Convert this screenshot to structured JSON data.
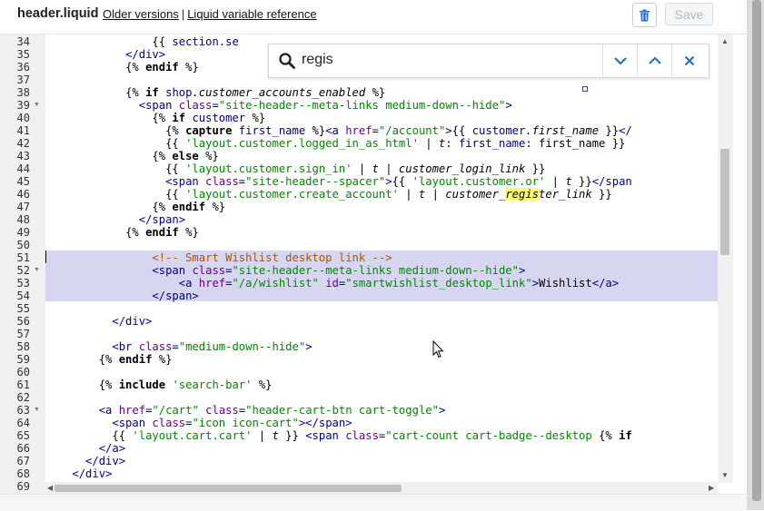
{
  "header": {
    "file_name": "header.liquid",
    "older_versions": "Older versions",
    "separator": "|",
    "liquid_reference": "Liquid variable reference",
    "save_label": "Save"
  },
  "search": {
    "query": "regis"
  },
  "colors": {
    "selection": "#d6d6f0",
    "match_highlight": "#ffff77",
    "save_disabled": "#b3bac2",
    "icon_blue": "#2c6ecb"
  },
  "icons": {
    "trash": "trash-icon",
    "search": "search-icon",
    "next": "chevron-down-icon",
    "prev": "chevron-up-icon",
    "close": "close-icon"
  },
  "lines": [
    {
      "n": "34",
      "fold": false
    },
    {
      "n": "35",
      "fold": false
    },
    {
      "n": "36",
      "fold": false
    },
    {
      "n": "37",
      "fold": false
    },
    {
      "n": "38",
      "fold": false
    },
    {
      "n": "39",
      "fold": true
    },
    {
      "n": "40",
      "fold": false
    },
    {
      "n": "41",
      "fold": false
    },
    {
      "n": "42",
      "fold": false
    },
    {
      "n": "43",
      "fold": false
    },
    {
      "n": "44",
      "fold": false
    },
    {
      "n": "45",
      "fold": false
    },
    {
      "n": "46",
      "fold": false
    },
    {
      "n": "47",
      "fold": false
    },
    {
      "n": "48",
      "fold": false
    },
    {
      "n": "49",
      "fold": false
    },
    {
      "n": "50",
      "fold": false
    },
    {
      "n": "51",
      "fold": false
    },
    {
      "n": "52",
      "fold": true
    },
    {
      "n": "53",
      "fold": false
    },
    {
      "n": "54",
      "fold": false
    },
    {
      "n": "55",
      "fold": false
    },
    {
      "n": "56",
      "fold": false
    },
    {
      "n": "57",
      "fold": false
    },
    {
      "n": "58",
      "fold": false
    },
    {
      "n": "59",
      "fold": false
    },
    {
      "n": "60",
      "fold": false
    },
    {
      "n": "61",
      "fold": false
    },
    {
      "n": "62",
      "fold": false
    },
    {
      "n": "63",
      "fold": true
    },
    {
      "n": "64",
      "fold": false
    },
    {
      "n": "65",
      "fold": false
    },
    {
      "n": "66",
      "fold": false
    },
    {
      "n": "67",
      "fold": false
    },
    {
      "n": "68",
      "fold": false
    },
    {
      "n": "69",
      "fold": false
    }
  ],
  "code": [
    {
      "indent": 16,
      "tokens": [
        {
          "t": "{{ ",
          "c": "liq"
        },
        {
          "t": "section.se",
          "c": "var"
        }
      ]
    },
    {
      "indent": 12,
      "tokens": [
        {
          "t": "</div>",
          "c": "tag"
        }
      ]
    },
    {
      "indent": 12,
      "tokens": [
        {
          "t": "{% ",
          "c": "liq"
        },
        {
          "t": "endif",
          "c": "kw"
        },
        {
          "t": " %}",
          "c": "liq"
        }
      ]
    },
    {
      "indent": 0,
      "tokens": []
    },
    {
      "indent": 12,
      "tokens": [
        {
          "t": "{% ",
          "c": "liq"
        },
        {
          "t": "if",
          "c": "kw"
        },
        {
          "t": " shop",
          "c": "var"
        },
        {
          "t": ".customer_accounts_enabled",
          "c": "it"
        },
        {
          "t": " %}",
          "c": "liq"
        }
      ]
    },
    {
      "indent": 14,
      "tokens": [
        {
          "t": "<span ",
          "c": "tag"
        },
        {
          "t": "class",
          "c": "attr"
        },
        {
          "t": "=",
          "c": "tag"
        },
        {
          "t": "\"site-header--meta-links medium-down--hide\"",
          "c": "str"
        },
        {
          "t": ">",
          "c": "tag"
        }
      ]
    },
    {
      "indent": 16,
      "tokens": [
        {
          "t": "{% ",
          "c": "liq"
        },
        {
          "t": "if",
          "c": "kw"
        },
        {
          "t": " customer",
          "c": "var"
        },
        {
          "t": " %}",
          "c": "liq"
        }
      ]
    },
    {
      "indent": 18,
      "tokens": [
        {
          "t": "{% ",
          "c": "liq"
        },
        {
          "t": "capture",
          "c": "kw"
        },
        {
          "t": " first_name",
          "c": "var"
        },
        {
          "t": " %}",
          "c": "liq"
        },
        {
          "t": "<a ",
          "c": "tag"
        },
        {
          "t": "href",
          "c": "attr"
        },
        {
          "t": "=",
          "c": "tag"
        },
        {
          "t": "\"/account\"",
          "c": "str"
        },
        {
          "t": ">",
          "c": "tag"
        },
        {
          "t": "{{ ",
          "c": "liq"
        },
        {
          "t": "customer",
          "c": "var"
        },
        {
          "t": ".first_name",
          "c": "it"
        },
        {
          "t": " }}",
          "c": "liq"
        },
        {
          "t": "</",
          "c": "tag"
        }
      ]
    },
    {
      "indent": 18,
      "tokens": [
        {
          "t": "{{ ",
          "c": "liq"
        },
        {
          "t": "'layout.customer.logged_in_as_html'",
          "c": "lstr"
        },
        {
          "t": " | ",
          "c": "pipe"
        },
        {
          "t": "t",
          "c": "it"
        },
        {
          "t": ": ",
          "c": "liq"
        },
        {
          "t": "first_name",
          "c": "var"
        },
        {
          "t": ": first_name }}",
          "c": "liq"
        }
      ]
    },
    {
      "indent": 16,
      "tokens": [
        {
          "t": "{% ",
          "c": "liq"
        },
        {
          "t": "else",
          "c": "kw"
        },
        {
          "t": " %}",
          "c": "liq"
        }
      ]
    },
    {
      "indent": 18,
      "tokens": [
        {
          "t": "{{ ",
          "c": "liq"
        },
        {
          "t": "'layout.customer.sign_in'",
          "c": "lstr"
        },
        {
          "t": " | ",
          "c": "pipe"
        },
        {
          "t": "t",
          "c": "it"
        },
        {
          "t": " | ",
          "c": "pipe"
        },
        {
          "t": "customer_login_link",
          "c": "it"
        },
        {
          "t": " }}",
          "c": "liq"
        }
      ]
    },
    {
      "indent": 18,
      "tokens": [
        {
          "t": "<span ",
          "c": "tag"
        },
        {
          "t": "class",
          "c": "attr"
        },
        {
          "t": "=",
          "c": "tag"
        },
        {
          "t": "\"site-header--spacer\"",
          "c": "str"
        },
        {
          "t": ">",
          "c": "tag"
        },
        {
          "t": "{{ ",
          "c": "liq"
        },
        {
          "t": "'layout.customer.or'",
          "c": "lstr"
        },
        {
          "t": " | ",
          "c": "pipe"
        },
        {
          "t": "t",
          "c": "it"
        },
        {
          "t": " }}",
          "c": "liq"
        },
        {
          "t": "</span",
          "c": "tag"
        }
      ]
    },
    {
      "indent": 18,
      "tokens": [
        {
          "t": "{{ ",
          "c": "liq"
        },
        {
          "t": "'layout.customer.create_account'",
          "c": "lstr"
        },
        {
          "t": " | ",
          "c": "pipe"
        },
        {
          "t": "t",
          "c": "it"
        },
        {
          "t": " | ",
          "c": "pipe"
        },
        {
          "t": "customer_",
          "c": "it"
        },
        {
          "t": "regis",
          "c": "ithl"
        },
        {
          "t": "ter_link",
          "c": "it"
        },
        {
          "t": " }}",
          "c": "liq"
        }
      ]
    },
    {
      "indent": 16,
      "tokens": [
        {
          "t": "{% ",
          "c": "liq"
        },
        {
          "t": "endif",
          "c": "kw"
        },
        {
          "t": " %}",
          "c": "liq"
        }
      ]
    },
    {
      "indent": 14,
      "tokens": [
        {
          "t": "</span>",
          "c": "tag"
        }
      ]
    },
    {
      "indent": 12,
      "tokens": [
        {
          "t": "{% ",
          "c": "liq"
        },
        {
          "t": "endif",
          "c": "kw"
        },
        {
          "t": " %}",
          "c": "liq"
        }
      ]
    },
    {
      "indent": 0,
      "tokens": []
    },
    {
      "indent": 16,
      "tokens": [
        {
          "t": "<!-- Smart Wishlist desktop link -->",
          "c": "cmt"
        }
      ]
    },
    {
      "indent": 16,
      "tokens": [
        {
          "t": "<span ",
          "c": "tag"
        },
        {
          "t": "class",
          "c": "attr"
        },
        {
          "t": "=",
          "c": "tag"
        },
        {
          "t": "\"site-header--meta-links medium-down--hide\"",
          "c": "str"
        },
        {
          "t": ">",
          "c": "tag"
        }
      ]
    },
    {
      "indent": 20,
      "tokens": [
        {
          "t": "<a ",
          "c": "tag"
        },
        {
          "t": "href",
          "c": "attr"
        },
        {
          "t": "=",
          "c": "tag"
        },
        {
          "t": "\"/a/wishlist\"",
          "c": "str"
        },
        {
          "t": " ",
          "c": "tag"
        },
        {
          "t": "id",
          "c": "attr"
        },
        {
          "t": "=",
          "c": "tag"
        },
        {
          "t": "\"smartwishlist_desktop_link\"",
          "c": "str"
        },
        {
          "t": ">",
          "c": "tag"
        },
        {
          "t": "Wishlist",
          "c": "liq"
        },
        {
          "t": "</a>",
          "c": "tag"
        }
      ]
    },
    {
      "indent": 16,
      "tokens": [
        {
          "t": "</span>",
          "c": "tag"
        }
      ]
    },
    {
      "indent": 0,
      "tokens": []
    },
    {
      "indent": 10,
      "tokens": [
        {
          "t": "</div>",
          "c": "tag"
        }
      ]
    },
    {
      "indent": 0,
      "tokens": []
    },
    {
      "indent": 10,
      "tokens": [
        {
          "t": "<br ",
          "c": "tag"
        },
        {
          "t": "class",
          "c": "attr"
        },
        {
          "t": "=",
          "c": "tag"
        },
        {
          "t": "\"medium-down--hide\"",
          "c": "str"
        },
        {
          "t": ">",
          "c": "tag"
        }
      ]
    },
    {
      "indent": 8,
      "tokens": [
        {
          "t": "{% ",
          "c": "liq"
        },
        {
          "t": "endif",
          "c": "kw"
        },
        {
          "t": " %}",
          "c": "liq"
        }
      ]
    },
    {
      "indent": 0,
      "tokens": []
    },
    {
      "indent": 8,
      "tokens": [
        {
          "t": "{% ",
          "c": "liq"
        },
        {
          "t": "include",
          "c": "kw"
        },
        {
          "t": " ",
          "c": "liq"
        },
        {
          "t": "'search-bar'",
          "c": "lstr"
        },
        {
          "t": " %}",
          "c": "liq"
        }
      ]
    },
    {
      "indent": 0,
      "tokens": []
    },
    {
      "indent": 8,
      "tokens": [
        {
          "t": "<a ",
          "c": "tag"
        },
        {
          "t": "href",
          "c": "attr"
        },
        {
          "t": "=",
          "c": "tag"
        },
        {
          "t": "\"/cart\"",
          "c": "str"
        },
        {
          "t": " ",
          "c": "tag"
        },
        {
          "t": "class",
          "c": "attr"
        },
        {
          "t": "=",
          "c": "tag"
        },
        {
          "t": "\"header-cart-btn cart-toggle\"",
          "c": "str"
        },
        {
          "t": ">",
          "c": "tag"
        }
      ]
    },
    {
      "indent": 10,
      "tokens": [
        {
          "t": "<span ",
          "c": "tag"
        },
        {
          "t": "class",
          "c": "attr"
        },
        {
          "t": "=",
          "c": "tag"
        },
        {
          "t": "\"icon icon-cart\"",
          "c": "str"
        },
        {
          "t": "></span>",
          "c": "tag"
        }
      ]
    },
    {
      "indent": 10,
      "tokens": [
        {
          "t": "{{ ",
          "c": "liq"
        },
        {
          "t": "'layout.cart.cart'",
          "c": "lstr"
        },
        {
          "t": " | ",
          "c": "pipe"
        },
        {
          "t": "t",
          "c": "it"
        },
        {
          "t": " }} ",
          "c": "liq"
        },
        {
          "t": "<span ",
          "c": "tag"
        },
        {
          "t": "class",
          "c": "attr"
        },
        {
          "t": "=",
          "c": "tag"
        },
        {
          "t": "\"cart-count cart-badge--desktop ",
          "c": "str"
        },
        {
          "t": "{% ",
          "c": "liq"
        },
        {
          "t": "if",
          "c": "kw"
        }
      ]
    },
    {
      "indent": 8,
      "tokens": [
        {
          "t": "</a>",
          "c": "tag"
        }
      ]
    },
    {
      "indent": 6,
      "tokens": [
        {
          "t": "</div>",
          "c": "tag"
        }
      ]
    },
    {
      "indent": 4,
      "tokens": [
        {
          "t": "</div>",
          "c": "tag"
        }
      ]
    },
    {
      "indent": 0,
      "tokens": []
    }
  ]
}
